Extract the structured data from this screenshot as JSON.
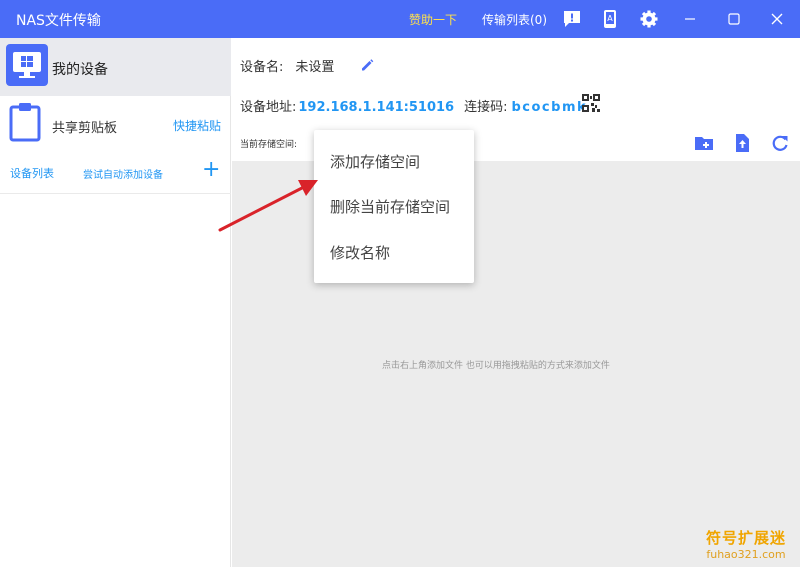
{
  "titlebar": {
    "app_title": "NAS文件传输",
    "sponsor": "赞助一下",
    "transfer_list": "传输列表(0)",
    "bg_color": "#4a6cf7",
    "sponsor_color": "#ffe14d",
    "icons": [
      "feedback-icon",
      "phone-icon",
      "settings-icon",
      "minimize-icon",
      "maximize-icon",
      "close-icon"
    ]
  },
  "sidebar": {
    "my_device": "我的设备",
    "shared_clipboard": "共享剪贴板",
    "quick_paste": "快捷粘贴",
    "device_list": "设备列表",
    "auto_add": "尝试自动添加设备",
    "add_symbol": "+"
  },
  "main": {
    "device_name_label": "设备名:",
    "device_name_value": "未设置",
    "address_label": "设备地址:",
    "address_value": "192.168.1.141:51016",
    "code_label": "连接码:",
    "code_value": "bcocbmk",
    "storage_label": "当前存储空间:",
    "empty_hint": "点击右上角添加文件 也可以用拖拽粘贴的方式来添加文件",
    "accent_color": "#2196f3"
  },
  "context_menu": {
    "items": [
      "添加存储空间",
      "删除当前存储空间",
      "修改名称"
    ]
  },
  "watermark": {
    "cn": "符号扩展迷",
    "en": "fuhao321.com"
  }
}
